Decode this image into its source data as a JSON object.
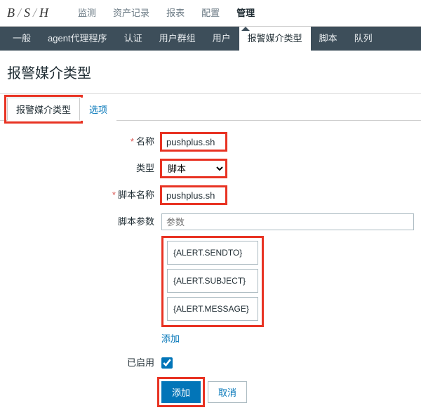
{
  "brand": {
    "b": "B",
    "s": "S",
    "h": "H"
  },
  "topnav": {
    "items": [
      "监测",
      "资产记录",
      "报表",
      "配置",
      "管理"
    ],
    "activeIndex": 4
  },
  "subnav": {
    "items": [
      "一般",
      "agent代理程序",
      "认证",
      "用户群组",
      "用户",
      "报警媒介类型",
      "脚本",
      "队列"
    ],
    "activeIndex": 5
  },
  "pageTitle": "报警媒介类型",
  "tabs": {
    "items": [
      "报警媒介类型",
      "选项"
    ],
    "activeIndex": 0
  },
  "form": {
    "name": {
      "label": "名称",
      "value": "pushplus.sh",
      "required": true
    },
    "type": {
      "label": "类型",
      "value": "脚本"
    },
    "scriptName": {
      "label": "脚本名称",
      "value": "pushplus.sh",
      "required": true
    },
    "scriptParams": {
      "label": "脚本参数",
      "placeholder": "参数",
      "items": [
        "{ALERT.SENDTO}",
        "{ALERT.SUBJECT}",
        "{ALERT.MESSAGE}"
      ],
      "addLabel": "添加"
    },
    "enabled": {
      "label": "已启用",
      "value": true
    },
    "buttons": {
      "submit": "添加",
      "cancel": "取消"
    }
  }
}
